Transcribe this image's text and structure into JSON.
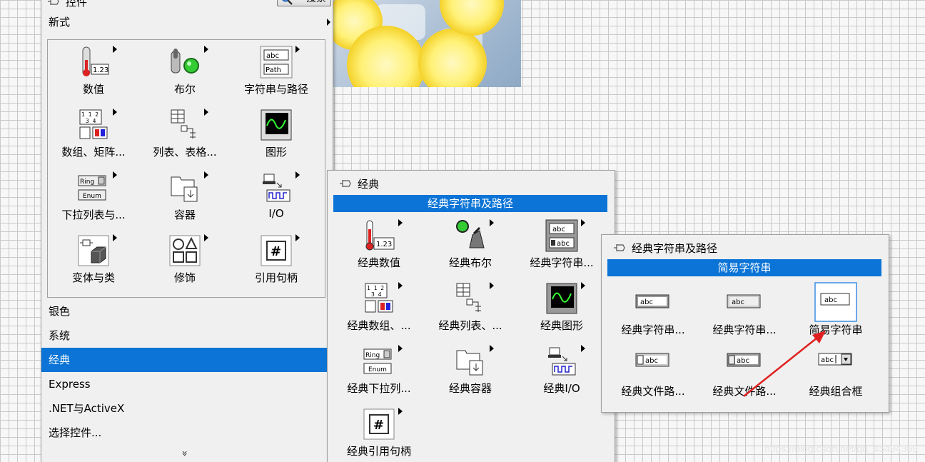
{
  "controls_palette": {
    "title": "控件",
    "search_label": "搜索",
    "top_category": "新式",
    "items": [
      {
        "label": "数值",
        "icon": "numeric-icon"
      },
      {
        "label": "布尔",
        "icon": "boolean-icon"
      },
      {
        "label": "字符串与路径",
        "icon": "string-path-icon"
      },
      {
        "label": "数组、矩阵...",
        "icon": "array-matrix-icon"
      },
      {
        "label": "列表、表格...",
        "icon": "list-table-icon"
      },
      {
        "label": "图形",
        "icon": "graph-icon"
      },
      {
        "label": "下拉列表与...",
        "icon": "ring-enum-icon"
      },
      {
        "label": "容器",
        "icon": "container-icon"
      },
      {
        "label": "I/O",
        "icon": "io-icon"
      },
      {
        "label": "变体与类",
        "icon": "variant-class-icon"
      },
      {
        "label": "修饰",
        "icon": "decorations-icon"
      },
      {
        "label": "引用句柄",
        "icon": "refnum-icon"
      }
    ],
    "categories": [
      {
        "label": "银色"
      },
      {
        "label": "系统"
      },
      {
        "label": "经典"
      },
      {
        "label": "Express"
      },
      {
        "label": ".NET与ActiveX"
      },
      {
        "label": "选择控件..."
      }
    ],
    "more_chevron": "»"
  },
  "classic_palette": {
    "title": "经典",
    "header": "经典字符串及路径",
    "items": [
      {
        "label": "经典数值",
        "icon": "classic-numeric-icon"
      },
      {
        "label": "经典布尔",
        "icon": "classic-boolean-icon"
      },
      {
        "label": "经典字符串...",
        "icon": "classic-string-icon"
      },
      {
        "label": "经典数组、...",
        "icon": "classic-array-icon"
      },
      {
        "label": "经典列表、...",
        "icon": "classic-list-icon"
      },
      {
        "label": "经典图形",
        "icon": "classic-graph-icon"
      },
      {
        "label": "经典下拉列...",
        "icon": "classic-ring-icon"
      },
      {
        "label": "经典容器",
        "icon": "classic-container-icon"
      },
      {
        "label": "经典I/O",
        "icon": "classic-io-icon"
      },
      {
        "label": "经典引用句柄",
        "icon": "classic-refnum-icon"
      }
    ]
  },
  "string_palette": {
    "title": "经典字符串及路径",
    "header": "简易字符串",
    "items": [
      {
        "label": "经典字符串...",
        "icon": "string-indicator-icon"
      },
      {
        "label": "经典字符串...",
        "icon": "string-control-icon"
      },
      {
        "label": "简易字符串",
        "icon": "simple-string-icon"
      },
      {
        "label": "经典文件路...",
        "icon": "file-path-control-icon"
      },
      {
        "label": "经典文件路...",
        "icon": "file-path-indicator-icon"
      },
      {
        "label": "经典组合框",
        "icon": "combo-box-icon"
      }
    ]
  },
  "watermark": "https://blog.csdn.net/qq_45494369",
  "colors": {
    "selection": "#0b74d6",
    "annotation_arrow": "#e02020"
  }
}
